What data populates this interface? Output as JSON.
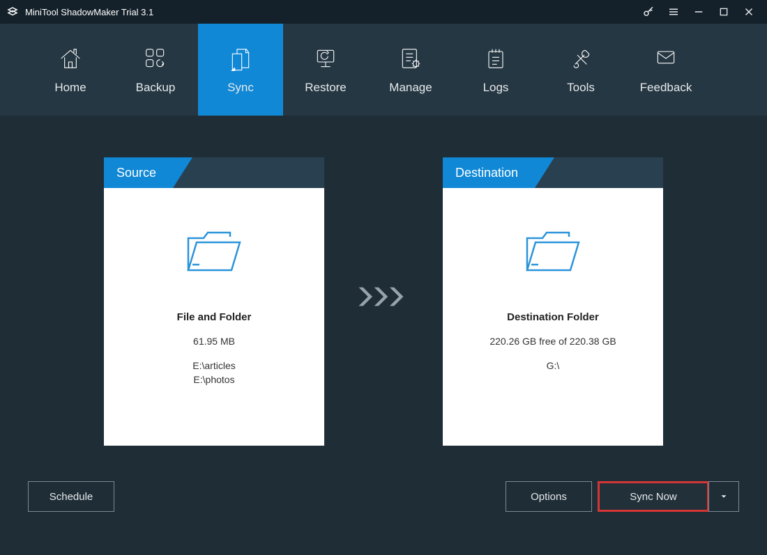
{
  "app": {
    "title": "MiniTool ShadowMaker Trial 3.1"
  },
  "nav": {
    "items": [
      {
        "label": "Home"
      },
      {
        "label": "Backup"
      },
      {
        "label": "Sync"
      },
      {
        "label": "Restore"
      },
      {
        "label": "Manage"
      },
      {
        "label": "Logs"
      },
      {
        "label": "Tools"
      },
      {
        "label": "Feedback"
      }
    ],
    "activeIndex": 2
  },
  "source": {
    "tab": "Source",
    "title": "File and Folder",
    "size": "61.95 MB",
    "path1": "E:\\articles",
    "path2": "E:\\photos"
  },
  "destination": {
    "tab": "Destination",
    "title": "Destination Folder",
    "space": "220.26 GB free of 220.38 GB",
    "path": "G:\\"
  },
  "buttons": {
    "schedule": "Schedule",
    "options": "Options",
    "syncNow": "Sync Now"
  },
  "colors": {
    "accent": "#1088d6",
    "bg": "#1f2d36",
    "navbg": "#253742",
    "highlight": "#d53635"
  }
}
